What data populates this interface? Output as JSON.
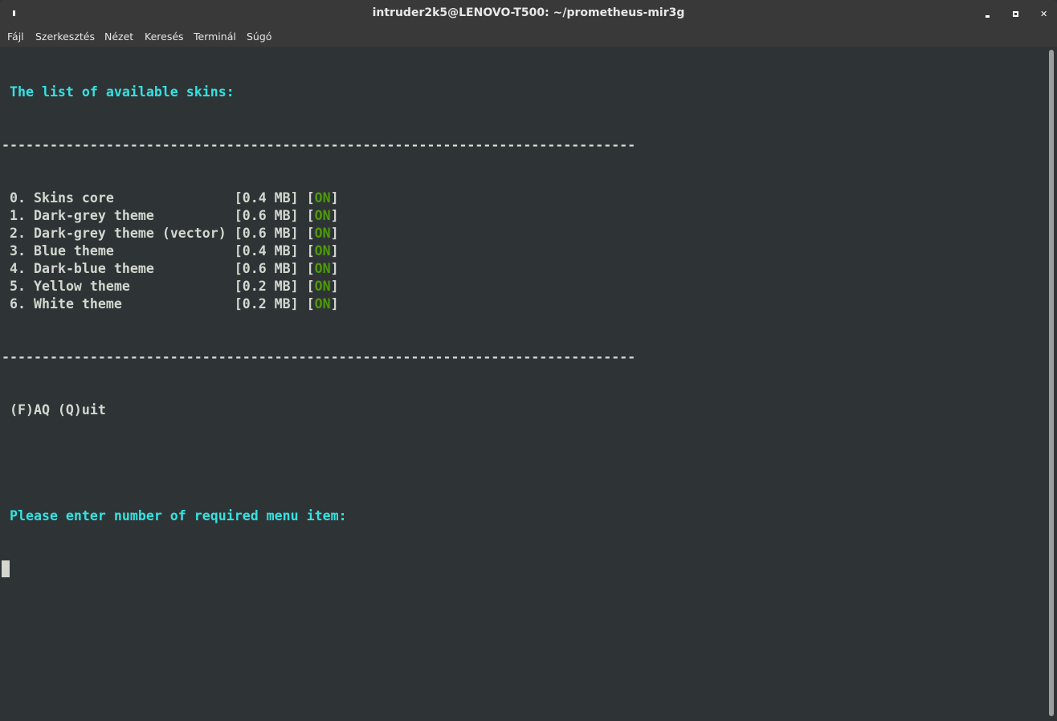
{
  "window": {
    "title": "intruder2k5@LENOVO-T500: ~/prometheus-mir3g"
  },
  "menu": [
    "Fájl",
    "Szerkesztés",
    "Nézet",
    "Keresés",
    "Terminál",
    "Súgó"
  ],
  "terminal": {
    "heading": " The list of available skins:",
    "separator": "-------------------------------------------------------------------------------",
    "skins": [
      {
        "num": "0.",
        "name": "Skins core",
        "size": "[0.4 MB]",
        "status": "ON"
      },
      {
        "num": "1.",
        "name": "Dark-grey theme",
        "size": "[0.6 MB]",
        "status": "ON"
      },
      {
        "num": "2.",
        "name": "Dark-grey theme (vector)",
        "size": "[0.6 MB]",
        "status": "ON"
      },
      {
        "num": "3.",
        "name": "Blue theme",
        "size": "[0.4 MB]",
        "status": "ON"
      },
      {
        "num": "4.",
        "name": "Dark-blue theme",
        "size": "[0.6 MB]",
        "status": "ON"
      },
      {
        "num": "5.",
        "name": "Yellow theme",
        "size": "[0.2 MB]",
        "status": "ON"
      },
      {
        "num": "6.",
        "name": "White theme",
        "size": "[0.2 MB]",
        "status": "ON"
      }
    ],
    "options": " (F)AQ (Q)uit",
    "prompt": " Please enter number of required menu item:"
  },
  "colors": {
    "bg": "#2e3436",
    "cyan": "#34e2e2",
    "green": "#4e9a06",
    "text": "#d3d7cf"
  }
}
